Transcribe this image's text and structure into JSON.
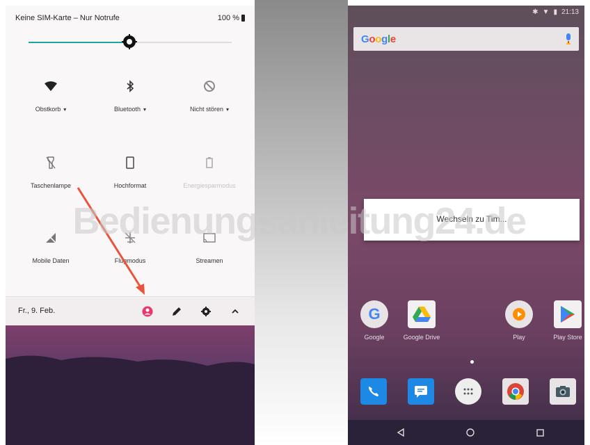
{
  "left_phone": {
    "status": {
      "carrier": "Keine SIM-Karte – Nur Notrufe",
      "battery": "100 %"
    },
    "brightness": {
      "level": 0.5
    },
    "tiles": [
      {
        "label": "Obstkorb",
        "icon": "wifi-icon",
        "dropdown": true
      },
      {
        "label": "Bluetooth",
        "icon": "bluetooth-icon",
        "dropdown": true
      },
      {
        "label": "Nicht stören",
        "icon": "do-not-disturb-icon",
        "dropdown": true
      },
      {
        "label": "Taschenlampe",
        "icon": "flashlight-icon"
      },
      {
        "label": "Hochformat",
        "icon": "portrait-icon"
      },
      {
        "label": "Energiesparmodus",
        "icon": "battery-saver-icon",
        "disabled": true
      },
      {
        "label": "Mobile Daten",
        "icon": "mobile-data-icon"
      },
      {
        "label": "Flugmodus",
        "icon": "airplane-icon"
      },
      {
        "label": "Streamen",
        "icon": "cast-icon"
      }
    ],
    "footer": {
      "date": "Fr., 9. Feb.",
      "buttons": [
        "user-icon",
        "edit-icon",
        "settings-icon",
        "chevron-up-icon"
      ]
    },
    "colors": {
      "accent": "#1aa5a0",
      "user": "#e8366a",
      "arrow": "#e8543c"
    }
  },
  "right_phone": {
    "status": {
      "time": "21:13"
    },
    "search": {
      "logo": "Google"
    },
    "dialog": {
      "text": "Wechseln zu Tim..."
    },
    "apps": [
      {
        "label": "Google",
        "icon": "google-icon"
      },
      {
        "label": "Google Drive",
        "icon": "drive-icon"
      },
      {
        "label": "Play",
        "icon": "play-music-icon"
      },
      {
        "label": "Play Store",
        "icon": "play-store-icon"
      }
    ],
    "dock": [
      "phone-icon",
      "messages-icon",
      "app-drawer-icon",
      "chrome-icon",
      "camera-icon"
    ],
    "nav": [
      "back-icon",
      "home-icon",
      "recents-icon"
    ]
  },
  "watermark": "Bedienungsanleitung24.de"
}
